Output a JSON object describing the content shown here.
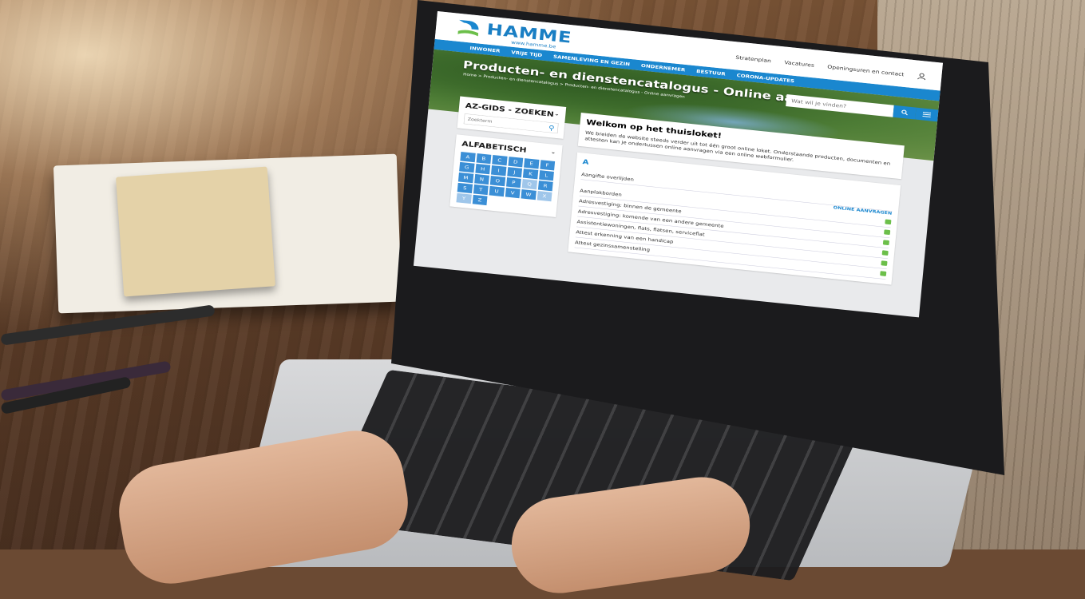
{
  "site": {
    "logo_text": "HAMME",
    "logo_url": "www.hamme.be",
    "top_links": [
      "Stratenplan",
      "Vacatures",
      "Openingsuren en contact"
    ],
    "main_nav": [
      "INWONER",
      "VRIJE TIJD",
      "SAMENLEVING EN GEZIN",
      "ONDERNEMER",
      "BESTUUR",
      "CORONA-UPDATES"
    ],
    "search_placeholder": "Wat wil je vinden?",
    "hero_title": "Producten- en dienstencatalogus - Online aanvragen",
    "breadcrumb": "Home > Producten- en dienstencatalogus > Producten- en dienstencatalogus - Online aanvragen"
  },
  "sidebar": {
    "az_title": "AZ-GIDS - ZOEKEN",
    "az_placeholder": "Zoekterm",
    "alpha_title": "ALFABETISCH",
    "letters": [
      "A",
      "B",
      "C",
      "D",
      "E",
      "F",
      "G",
      "H",
      "I",
      "J",
      "K",
      "L",
      "M",
      "N",
      "O",
      "P",
      "Q",
      "R",
      "S",
      "T",
      "U",
      "V",
      "W",
      "X",
      "Y",
      "Z"
    ],
    "inactive_letters": [
      "Q",
      "X",
      "Y"
    ]
  },
  "main": {
    "welcome_title": "Welkom op het thuisloket!",
    "welcome_text": "We breiden de website steeds verder uit tot één groot online loket. Onderstaande producten, documenten en attesten kan je ondertussen online aanvragen via een online webformulier.",
    "section_letter": "A",
    "online_label": "ONLINE AANVRAGEN",
    "items": [
      "Aangifte overlijden",
      "Aanplakborden",
      "Adresvestiging: binnen de gemeente",
      "Adresvestiging: komende van een andere gemeente",
      "Assistentiewoningen, flats, flatsen, serviceflat",
      "Attest erkenning van een handicap",
      "Attest gezinssamenstelling"
    ]
  },
  "colors": {
    "brand_blue": "#1a87cf",
    "check_green": "#6cbf4a"
  }
}
